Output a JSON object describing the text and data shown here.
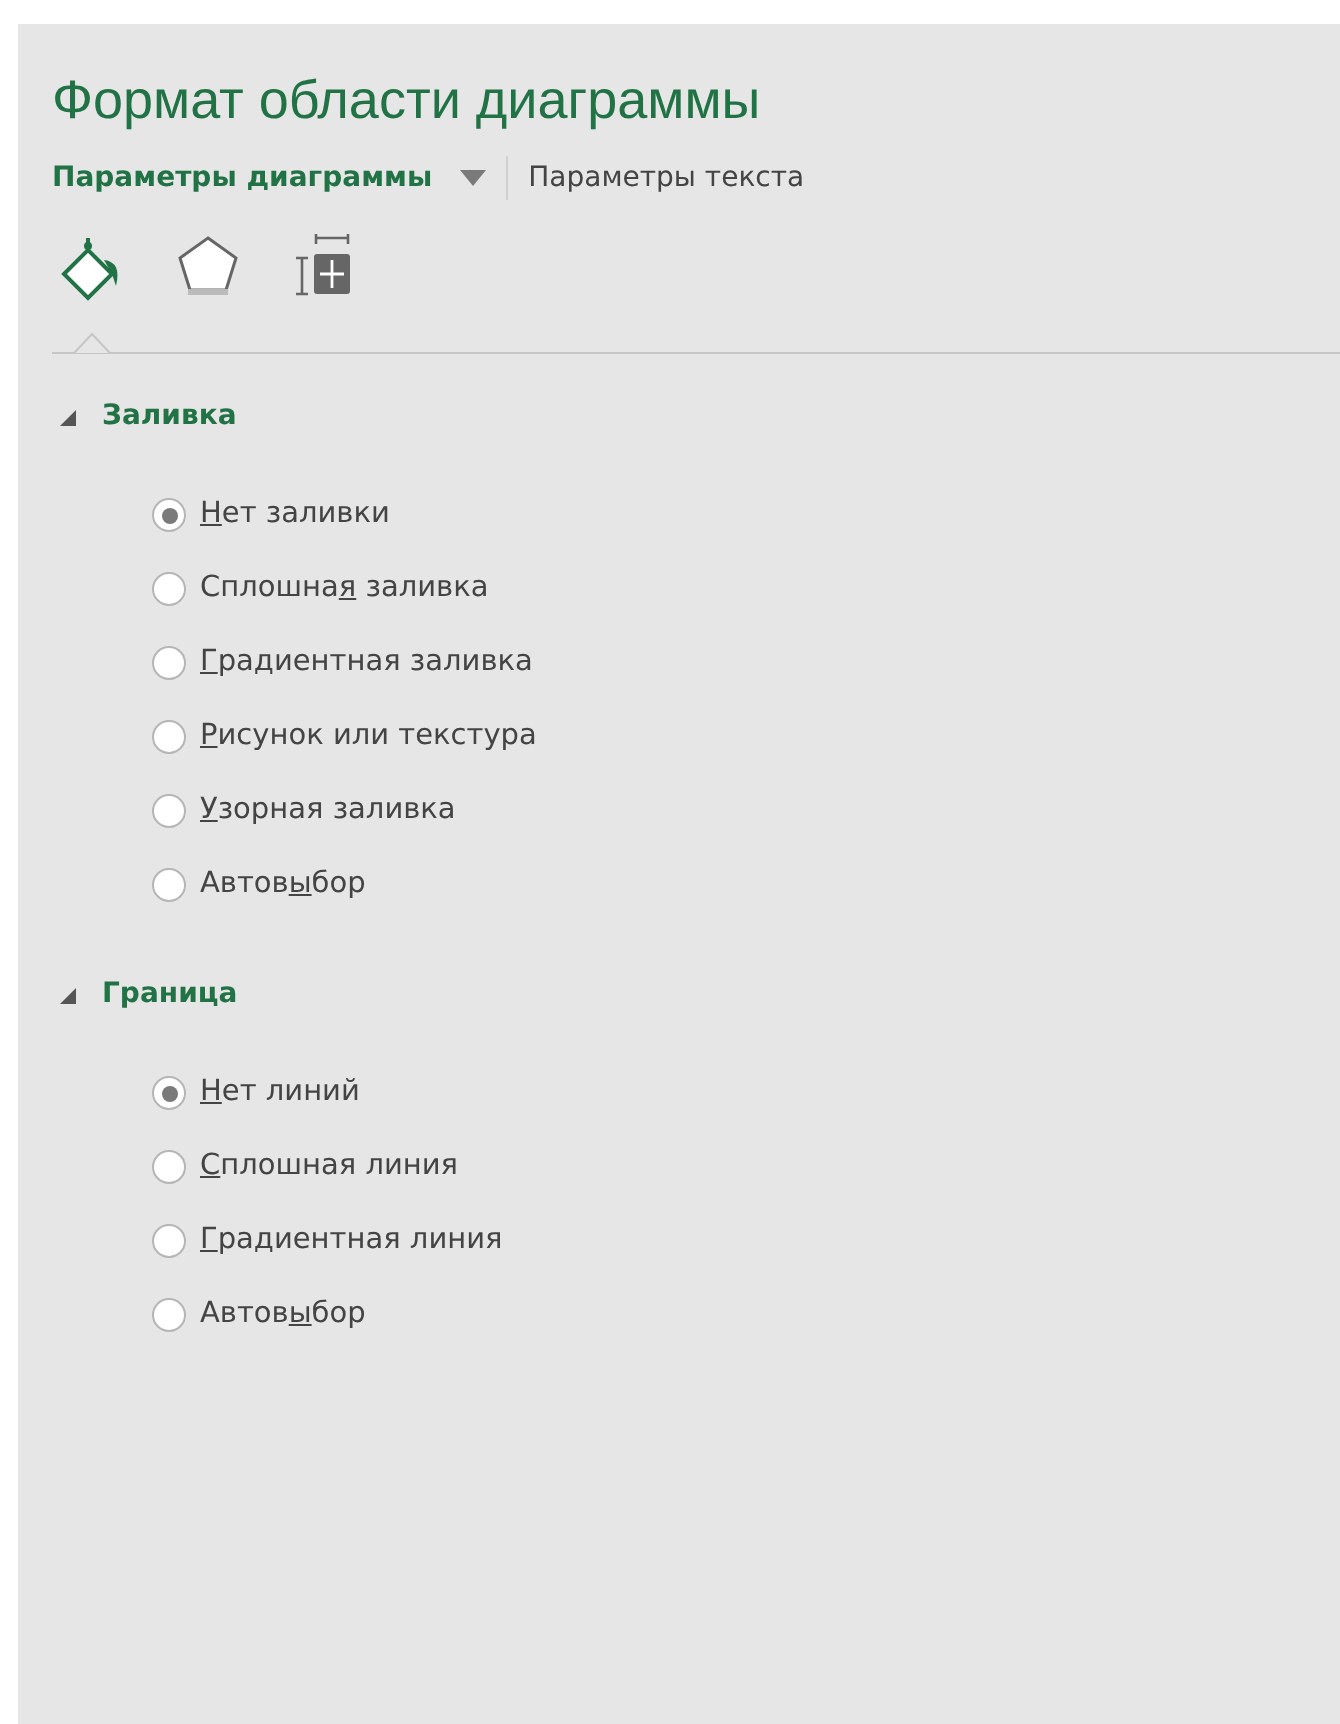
{
  "pane": {
    "title": "Формат области диаграммы"
  },
  "option_tabs": [
    {
      "label": "Параметры диаграммы",
      "selected": true,
      "has_dropdown": true
    },
    {
      "label": "Параметры текста",
      "selected": false,
      "has_dropdown": false
    }
  ],
  "icon_tabs": [
    {
      "kind": "fill",
      "selected": true
    },
    {
      "kind": "effects",
      "selected": false
    },
    {
      "kind": "size",
      "selected": false
    }
  ],
  "sections": [
    {
      "title": "Заливка",
      "expanded": true,
      "options": [
        {
          "hotkey": "Н",
          "label_end": "ет заливки",
          "selected": true
        },
        {
          "label_start": "Сплошна",
          "hotkey": "я",
          "label_end": " заливка",
          "selected": false
        },
        {
          "hotkey": "Г",
          "label_end": "радиентная заливка",
          "selected": false
        },
        {
          "hotkey": "Р",
          "label_end": "исунок или текстура",
          "selected": false
        },
        {
          "hotkey": "У",
          "label_end": "зорная заливка",
          "selected": false
        },
        {
          "label_start": "Автов",
          "hotkey": "ы",
          "label_end": "бор",
          "selected": false
        }
      ]
    },
    {
      "title": "Граница",
      "expanded": true,
      "options": [
        {
          "hotkey": "Н",
          "label_end": "ет линий",
          "selected": true
        },
        {
          "hotkey": "С",
          "label_end": "плошная линия",
          "selected": false
        },
        {
          "hotkey": "Г",
          "label_end": "радиентная линия",
          "selected": false
        },
        {
          "label_start": "Автов",
          "hotkey": "ы",
          "label_end": "бор",
          "selected": false
        }
      ]
    }
  ]
}
